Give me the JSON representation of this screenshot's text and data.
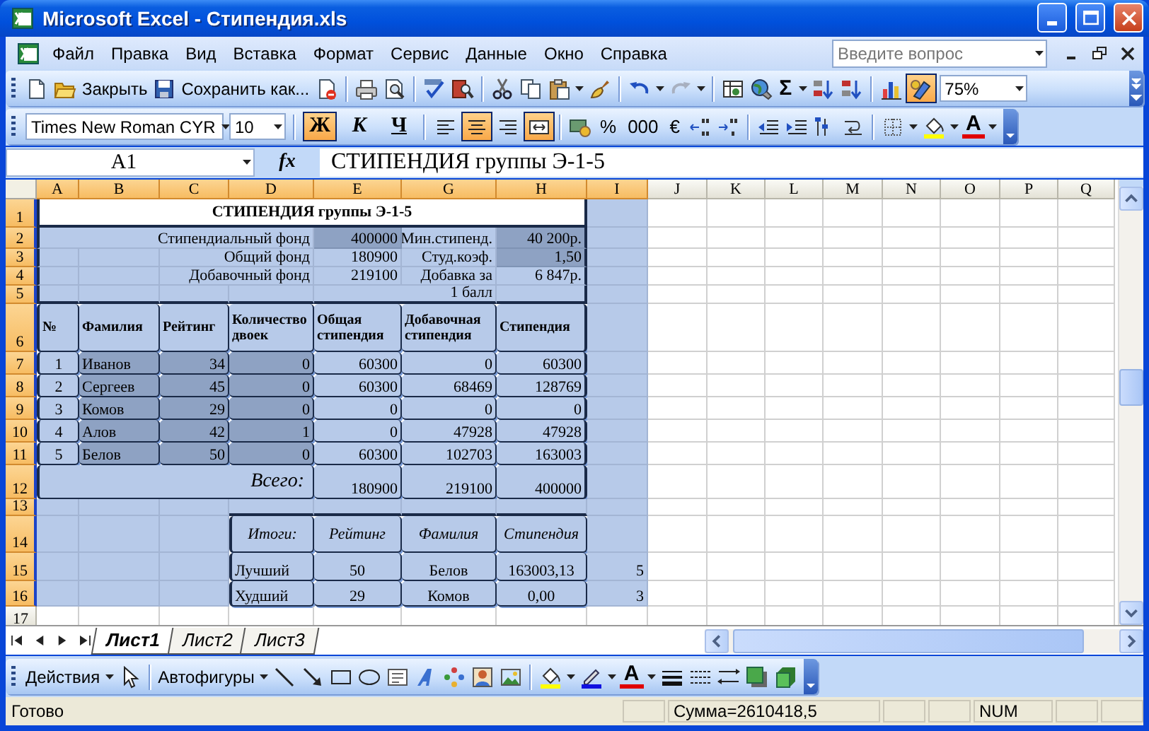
{
  "title_bar": {
    "title": "Microsoft Excel - Стипендия.xls"
  },
  "menu_bar": {
    "items": [
      "Файл",
      "Правка",
      "Вид",
      "Вставка",
      "Формат",
      "Сервис",
      "Данные",
      "Окно",
      "Справка"
    ],
    "help": {
      "placeholder": "Введите вопрос"
    }
  },
  "standard_toolbar": {
    "close": "Закрыть",
    "save_as": "Сохранить как...",
    "autosum": "Σ",
    "drawing_selected": true,
    "zoom": "75%"
  },
  "formatting_toolbar": {
    "font": "Times New Roman CYR",
    "size": "10",
    "styles": [
      {
        "label": "Ж",
        "selected": true
      },
      {
        "label": "К",
        "selected": false
      },
      {
        "label": "Ч",
        "selected": false
      }
    ],
    "alignment": [
      {
        "kind": "left",
        "selected": false
      },
      {
        "kind": "center",
        "selected": true
      },
      {
        "kind": "right",
        "selected": false
      },
      {
        "kind": "merge",
        "selected": true
      }
    ],
    "percent": "%",
    "thousands": "000",
    "euro": "€",
    "font_color": "A"
  },
  "formula_bar": {
    "name_box": "A1",
    "function_label": "fx",
    "formula": "СТИПЕНДИЯ группы Э-1-5"
  },
  "sheet": {
    "columns": [
      {
        "label": "A",
        "selected": true
      },
      {
        "label": "B",
        "selected": true
      },
      {
        "label": "C",
        "selected": true
      },
      {
        "label": "D",
        "selected": true
      },
      {
        "label": "E",
        "selected": true
      },
      {
        "label": "G",
        "selected": true
      },
      {
        "label": "H",
        "selected": true
      },
      {
        "label": "I",
        "selected": true
      },
      {
        "label": "J",
        "selected": false
      },
      {
        "label": "K",
        "selected": false
      },
      {
        "label": "L",
        "selected": false
      },
      {
        "label": "M",
        "selected": false
      },
      {
        "label": "N",
        "selected": false
      },
      {
        "label": "O",
        "selected": false
      },
      {
        "label": "P",
        "selected": false
      },
      {
        "label": "Q",
        "selected": false
      }
    ],
    "rows": [
      {
        "label": "1",
        "selected": true,
        "cells": {
          "A": "СТИПЕНДИЯ группы Э-1-5"
        }
      },
      {
        "label": "2",
        "selected": true,
        "cells": {
          "A": "Стипендиальный фонд",
          "E": "400000",
          "G": "Мин.стипенд.",
          "H": "40 200р."
        }
      },
      {
        "label": "3",
        "selected": true,
        "cells": {
          "D": "Общий фонд",
          "E": "180900",
          "G": "Студ.коэф.",
          "H": "1,50"
        }
      },
      {
        "label": "4",
        "selected": true,
        "cells": {
          "D": "Добавочный фонд",
          "E": "219100",
          "G": "Добавка за",
          "H": "6 847р."
        }
      },
      {
        "label": "5",
        "selected": true,
        "cells": {
          "G": "1 балл"
        }
      },
      {
        "label": "6",
        "selected": true,
        "cells": {
          "A": "№",
          "B": "Фамилия",
          "C": "Рейтинг",
          "D": "Количество двоек",
          "E": "Общая стипендия",
          "G": "Добавочная стипендия",
          "H": "Стипендия"
        }
      },
      {
        "label": "7",
        "selected": true,
        "cells": {
          "A": "1",
          "B": "Иванов",
          "C": "34",
          "D": "0",
          "E": "60300",
          "G": "0",
          "H": "60300"
        }
      },
      {
        "label": "8",
        "selected": true,
        "cells": {
          "A": "2",
          "B": "Сергеев",
          "C": "45",
          "D": "0",
          "E": "60300",
          "G": "68469",
          "H": "128769"
        }
      },
      {
        "label": "9",
        "selected": true,
        "cells": {
          "A": "3",
          "B": "Комов",
          "C": "29",
          "D": "0",
          "E": "0",
          "G": "0",
          "H": "0"
        }
      },
      {
        "label": "10",
        "selected": true,
        "cells": {
          "A": "4",
          "B": "Алов",
          "C": "42",
          "D": "1",
          "E": "0",
          "G": "47928",
          "H": "47928"
        }
      },
      {
        "label": "11",
        "selected": true,
        "cells": {
          "A": "5",
          "B": "Белов",
          "C": "50",
          "D": "0",
          "E": "60300",
          "G": "102703",
          "H": "163003"
        }
      },
      {
        "label": "12",
        "selected": true,
        "cells": {
          "A": "Всего:",
          "E": "180900",
          "G": "219100",
          "H": "400000"
        }
      },
      {
        "label": "13",
        "selected": true,
        "cells": {}
      },
      {
        "label": "14",
        "selected": true,
        "cells": {
          "D": "Итоги:",
          "E": "Рейтинг",
          "G": "Фамилия",
          "H": "Стипендия"
        }
      },
      {
        "label": "15",
        "selected": true,
        "cells": {
          "D": "Лучший",
          "E": "50",
          "G": "Белов",
          "H": "163003,13",
          "I": "5"
        }
      },
      {
        "label": "16",
        "selected": true,
        "cells": {
          "D": "Худший",
          "E": "29",
          "G": "Комов",
          "H": "0,00",
          "I": "3"
        }
      },
      {
        "label": "17",
        "selected": false,
        "cells": {}
      }
    ]
  },
  "sheet_tabs": [
    {
      "label": "Лист1",
      "selected": true
    },
    {
      "label": "Лист2",
      "selected": false
    },
    {
      "label": "Лист3",
      "selected": false
    }
  ],
  "drawing_toolbar": {
    "actions": "Действия",
    "autoshapes": "Автофигуры",
    "font_color": "A"
  },
  "status_bar": {
    "status": "Готово",
    "sum": "Сумма=2610418,5",
    "num": "NUM"
  }
}
